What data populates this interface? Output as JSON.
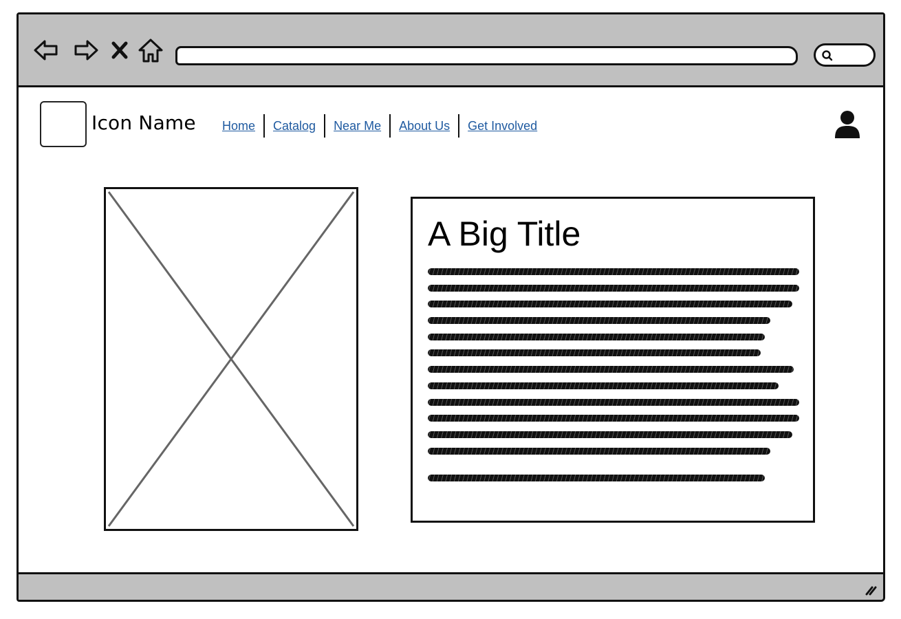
{
  "browser": {
    "back_icon": "back-arrow-icon",
    "forward_icon": "forward-arrow-icon",
    "stop_icon": "close-icon",
    "home_icon": "home-icon",
    "url": "",
    "search_icon": "search-icon"
  },
  "header": {
    "brand_name": "Icon Name",
    "nav": [
      {
        "label": "Home"
      },
      {
        "label": "Catalog"
      },
      {
        "label": "Near Me"
      },
      {
        "label": "About Us"
      },
      {
        "label": "Get Involved"
      }
    ],
    "user_icon": "user-icon"
  },
  "main": {
    "image_placeholder": "image-placeholder",
    "title": "A Big Title",
    "paragraph_lines": 12,
    "trailing_lines": 1
  },
  "colors": {
    "chrome": "#c0c0c0",
    "link": "#1f5aa0",
    "ink": "#111111"
  }
}
